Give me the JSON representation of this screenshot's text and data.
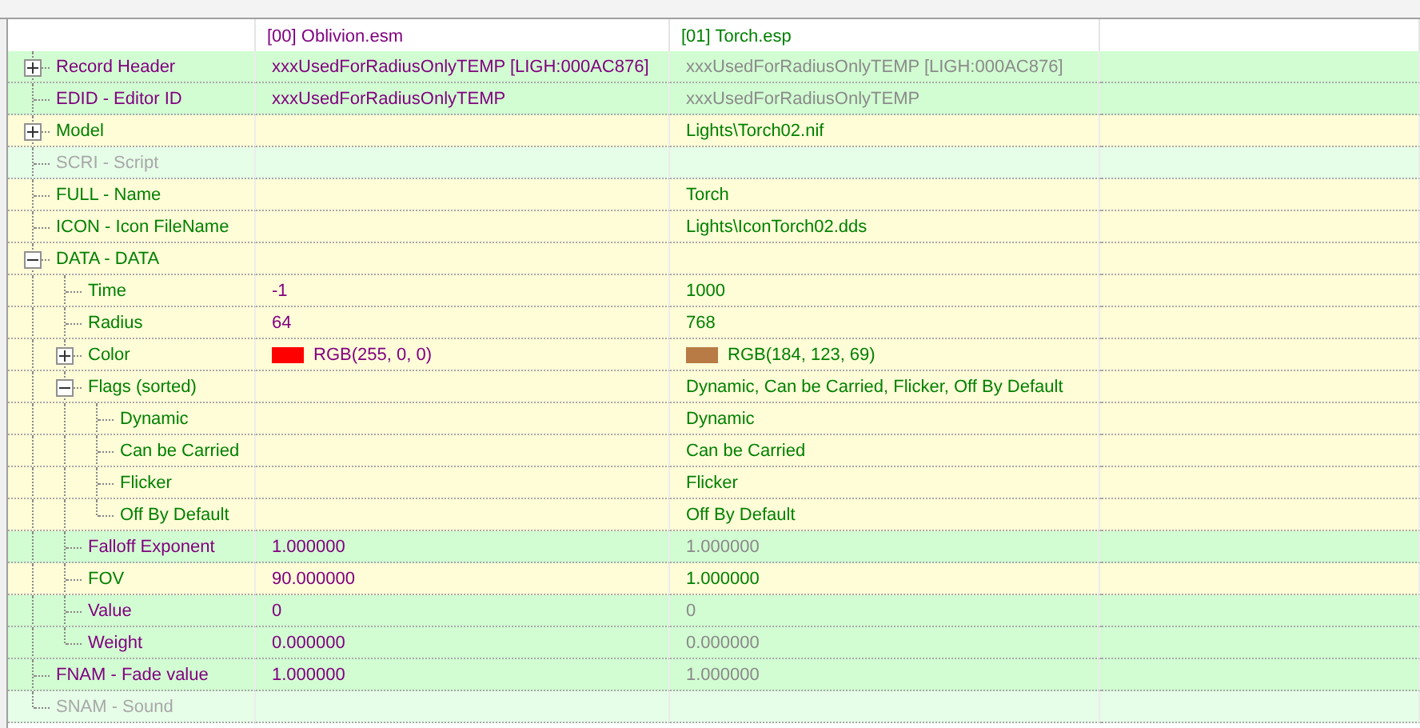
{
  "columns": [
    {
      "label": "[00] Oblivion.esm"
    },
    {
      "label": "[01] Torch.esp"
    }
  ],
  "records": [
    {
      "name": "Record Header",
      "changed": false,
      "empty": false,
      "expanded": false,
      "master": {
        "text": "xxxUsedForRadiusOnlyTEMP [LIGH:000AC876]"
      },
      "plugin": {
        "text": "xxxUsedForRadiusOnlyTEMP [LIGH:000AC876]"
      }
    },
    {
      "name": "EDID - Editor ID",
      "changed": false,
      "empty": false,
      "master": {
        "text": "xxxUsedForRadiusOnlyTEMP"
      },
      "plugin": {
        "text": "xxxUsedForRadiusOnlyTEMP"
      }
    },
    {
      "name": "Model",
      "changed": true,
      "empty": false,
      "expanded": false,
      "plugin": {
        "text": "Lights\\Torch02.nif"
      }
    },
    {
      "name": "SCRI - Script",
      "changed": false,
      "empty": true
    },
    {
      "name": "FULL - Name",
      "changed": true,
      "empty": false,
      "plugin": {
        "text": "Torch"
      }
    },
    {
      "name": "ICON - Icon FileName",
      "changed": true,
      "empty": false,
      "plugin": {
        "text": "Lights\\IconTorch02.dds"
      }
    },
    {
      "name": "DATA - DATA",
      "changed": true,
      "empty": false,
      "expanded": true,
      "children": [
        {
          "name": "Time",
          "changed": true,
          "empty": false,
          "master": {
            "text": "-1"
          },
          "plugin": {
            "text": "1000"
          }
        },
        {
          "name": "Radius",
          "changed": true,
          "empty": false,
          "master": {
            "text": "64"
          },
          "plugin": {
            "text": "768"
          }
        },
        {
          "name": "Color",
          "changed": true,
          "empty": false,
          "expanded": false,
          "master": {
            "text": "RGB(255, 0, 0)",
            "color": "#ff0000"
          },
          "plugin": {
            "text": "RGB(184, 123, 69)",
            "color": "#b87b45"
          }
        },
        {
          "name": "Flags (sorted)",
          "changed": true,
          "empty": false,
          "expanded": true,
          "plugin": {
            "text": "Dynamic, Can be Carried, Flicker, Off By Default"
          },
          "children": [
            {
              "name": "Dynamic",
              "changed": true,
              "empty": false,
              "plugin": {
                "text": "Dynamic"
              }
            },
            {
              "name": "Can be Carried",
              "changed": true,
              "empty": false,
              "plugin": {
                "text": "Can be Carried"
              }
            },
            {
              "name": "Flicker",
              "changed": true,
              "empty": false,
              "plugin": {
                "text": "Flicker"
              }
            },
            {
              "name": "Off By Default",
              "changed": true,
              "empty": false,
              "plugin": {
                "text": "Off By Default"
              }
            }
          ]
        },
        {
          "name": "Falloff Exponent",
          "changed": false,
          "empty": false,
          "master": {
            "text": "1.000000"
          },
          "plugin": {
            "text": "1.000000"
          }
        },
        {
          "name": "FOV",
          "changed": true,
          "empty": false,
          "master": {
            "text": "90.000000"
          },
          "plugin": {
            "text": "1.000000"
          }
        },
        {
          "name": "Value",
          "changed": false,
          "empty": false,
          "master": {
            "text": "0"
          },
          "plugin": {
            "text": "0"
          }
        },
        {
          "name": "Weight",
          "changed": false,
          "empty": false,
          "master": {
            "text": "0.000000"
          },
          "plugin": {
            "text": "0.000000"
          }
        }
      ]
    },
    {
      "name": "FNAM - Fade value",
      "changed": false,
      "empty": false,
      "master": {
        "text": "1.000000"
      },
      "plugin": {
        "text": "1.000000"
      }
    },
    {
      "name": "SNAM - Sound",
      "changed": false,
      "empty": true
    }
  ]
}
